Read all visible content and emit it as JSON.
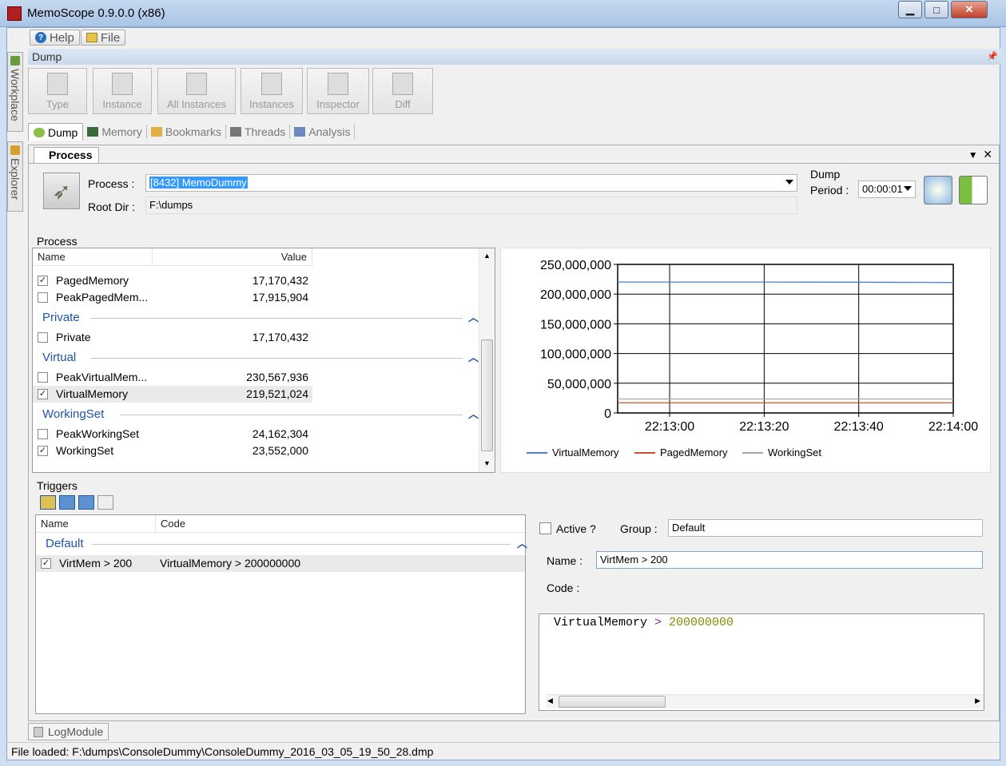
{
  "window": {
    "title": "MemoScope 0.9.0.0 (x86)"
  },
  "menu": {
    "help": "Help",
    "file": "File"
  },
  "side_tabs": {
    "workplace": "Workplace",
    "explorer": "Explorer"
  },
  "ribbon": {
    "group": "Dump",
    "buttons": [
      "Type",
      "Instance",
      "All Instances",
      "Instances",
      "Inspector",
      "Diff"
    ]
  },
  "module_tabs": [
    "Dump",
    "Memory",
    "Bookmarks",
    "Threads",
    "Analysis"
  ],
  "doc_tab": "Process",
  "process_form": {
    "process_label": "Process :",
    "process_value": "[8432] MemoDummy",
    "rootdir_label": "Root Dir :",
    "rootdir_value": "F:\\dumps",
    "dump_label": "Dump",
    "period_label": "Period :",
    "period_value": "00:00:01"
  },
  "process_group": {
    "title": "Process",
    "columns": {
      "name": "Name",
      "value": "Value"
    },
    "rows": [
      {
        "name": "PagedMemory",
        "value": "17,170,432",
        "checked": true
      },
      {
        "name": "PeakPagedMem...",
        "value": "17,915,904",
        "checked": false
      }
    ],
    "groups": [
      {
        "name": "Private",
        "rows": [
          {
            "name": "Private",
            "value": "17,170,432",
            "checked": false
          }
        ]
      },
      {
        "name": "Virtual",
        "rows": [
          {
            "name": "PeakVirtualMem...",
            "value": "230,567,936",
            "checked": false
          },
          {
            "name": "VirtualMemory",
            "value": "219,521,024",
            "checked": true
          }
        ]
      },
      {
        "name": "WorkingSet",
        "rows": [
          {
            "name": "PeakWorkingSet",
            "value": "24,162,304",
            "checked": false
          },
          {
            "name": "WorkingSet",
            "value": "23,552,000",
            "checked": true
          }
        ]
      }
    ]
  },
  "chart_data": {
    "type": "line",
    "x": [
      "22:12:49",
      "22:13:00",
      "22:13:20",
      "22:13:40",
      "22:14:00"
    ],
    "x_ticks": [
      "22:13:00",
      "22:13:20",
      "22:13:40",
      "22:14:00"
    ],
    "y_ticks": [
      "250,000,000",
      "200,000,000",
      "150,000,000",
      "100,000,000",
      "50,000,000",
      "0"
    ],
    "ylim": [
      0,
      250000000
    ],
    "xlim_seconds": [
      0,
      71
    ],
    "grid": true,
    "legend_position": "bottom",
    "series": [
      {
        "name": "VirtualMemory",
        "color": "#4a7fd0",
        "values": [
          220300000,
          220300000,
          220300000,
          220000000,
          219500000
        ]
      },
      {
        "name": "PagedMemory",
        "color": "#c8502a",
        "values": [
          17170432,
          17170432,
          17170432,
          17170432,
          17170432
        ]
      },
      {
        "name": "WorkingSet",
        "color": "#a8a8a8",
        "values": [
          23552000,
          23552000,
          23552000,
          23552000,
          23552000
        ]
      }
    ]
  },
  "triggers": {
    "title": "Triggers",
    "columns": {
      "name": "Name",
      "code": "Code"
    },
    "group": "Default",
    "row": {
      "name": "VirtMem > 200",
      "code": "VirtualMemory > 200000000",
      "checked": true
    },
    "active_label": "Active ?",
    "group_label": "Group :",
    "group_value": "Default",
    "name_label": "Name :",
    "name_value": "VirtMem > 200",
    "code_label": "Code :",
    "code_parts": {
      "ident": "VirtualMemory",
      "op": " > ",
      "num": "200000000"
    }
  },
  "log_tab": "LogModule",
  "status": "File loaded: F:\\dumps\\ConsoleDummy\\ConsoleDummy_2016_03_05_19_50_28.dmp"
}
